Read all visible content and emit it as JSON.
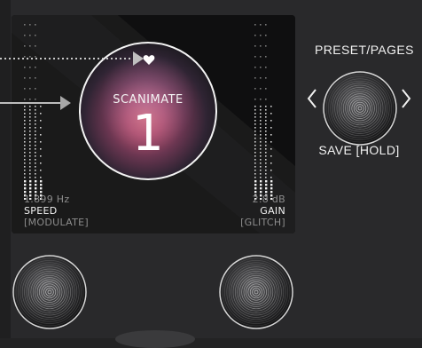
{
  "screen": {
    "preset": {
      "name": "SCANIMATE",
      "number": "1",
      "favorite_icon": "heart-icon"
    },
    "left_param": {
      "value": "1.899 Hz",
      "name": "SPEED",
      "alt": "[MODULATE]",
      "meter_level": 0.12
    },
    "right_param": {
      "value": "2.8 dB",
      "name": "GAIN",
      "alt": "[GLITCH]",
      "meter_level": 0.12
    }
  },
  "controls": {
    "preset_label": "PRESET/PAGES",
    "save_label": "SAVE [HOLD]",
    "prev_icon": "chevron-left-icon",
    "next_icon": "chevron-right-icon"
  },
  "colors": {
    "background": "#29292b",
    "screen": "#141414",
    "text": "#f2f2f2",
    "dim_text": "#8c8c8c",
    "accent": "#d86a7a"
  }
}
